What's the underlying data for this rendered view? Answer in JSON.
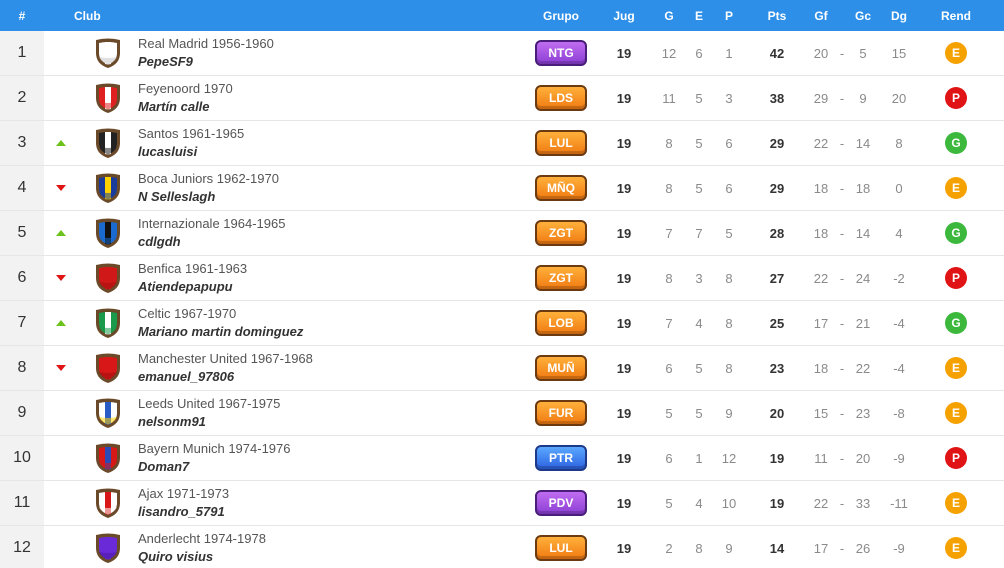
{
  "header": {
    "pos": "#",
    "club": "Club",
    "grupo": "Grupo",
    "jug": "Jug",
    "g": "G",
    "e": "E",
    "p": "P",
    "pts": "Pts",
    "gf": "Gf",
    "gc": "Gc",
    "dg": "Dg",
    "rend": "Rend"
  },
  "dash": "-",
  "rows": [
    {
      "pos": "1",
      "trend": "",
      "club": "Real Madrid 1956-1960",
      "user": "PepeSF9",
      "grupo": "NTG",
      "grupo_color": "purple",
      "jug": "19",
      "g": "12",
      "e": "6",
      "p": "1",
      "pts": "42",
      "gf": "20",
      "gc": "5",
      "dg": "15",
      "rend": "E",
      "rend_color": "#f5a200",
      "shield": [
        "#ffffff",
        "#ffffff",
        "#c7c7c7"
      ]
    },
    {
      "pos": "2",
      "trend": "",
      "club": "Feyenoord 1970",
      "user": "Martín calle",
      "grupo": "LDS",
      "grupo_color": "orange",
      "jug": "19",
      "g": "11",
      "e": "5",
      "p": "3",
      "pts": "38",
      "gf": "29",
      "gc": "9",
      "dg": "20",
      "rend": "P",
      "rend_color": "#e01414",
      "shield": [
        "#e02020",
        "#ffffff",
        "#e02020"
      ]
    },
    {
      "pos": "3",
      "trend": "up",
      "club": "Santos 1961-1965",
      "user": "lucasluisi",
      "grupo": "LUL",
      "grupo_color": "orange",
      "jug": "19",
      "g": "8",
      "e": "5",
      "p": "6",
      "pts": "29",
      "gf": "22",
      "gc": "14",
      "dg": "8",
      "rend": "G",
      "rend_color": "#3cb93c",
      "shield": [
        "#222222",
        "#ffffff",
        "#222222"
      ]
    },
    {
      "pos": "4",
      "trend": "down",
      "club": "Boca Juniors 1962-1970",
      "user": "N Selleslagh",
      "grupo": "MÑQ",
      "grupo_color": "orange",
      "jug": "19",
      "g": "8",
      "e": "5",
      "p": "6",
      "pts": "29",
      "gf": "18",
      "gc": "18",
      "dg": "0",
      "rend": "E",
      "rend_color": "#f5a200",
      "shield": [
        "#1a3d9c",
        "#ffd200",
        "#1a3d9c"
      ]
    },
    {
      "pos": "5",
      "trend": "up",
      "club": "Internazionale 1964-1965",
      "user": "cdlgdh",
      "grupo": "ZGT",
      "grupo_color": "orange",
      "jug": "19",
      "g": "7",
      "e": "7",
      "p": "5",
      "pts": "28",
      "gf": "18",
      "gc": "14",
      "dg": "4",
      "rend": "G",
      "rend_color": "#3cb93c",
      "shield": [
        "#1a6ad0",
        "#111111",
        "#1a6ad0"
      ]
    },
    {
      "pos": "6",
      "trend": "down",
      "club": "Benfica 1961-1963",
      "user": "Atiendepapupu",
      "grupo": "ZGT",
      "grupo_color": "orange",
      "jug": "19",
      "g": "8",
      "e": "3",
      "p": "8",
      "pts": "27",
      "gf": "22",
      "gc": "24",
      "dg": "-2",
      "rend": "P",
      "rend_color": "#e01414",
      "shield": [
        "#d01818",
        "#d01818",
        "#a81010"
      ]
    },
    {
      "pos": "7",
      "trend": "up",
      "club": "Celtic 1967-1970",
      "user": "Mariano martin dominguez",
      "grupo": "LOB",
      "grupo_color": "orange",
      "jug": "19",
      "g": "7",
      "e": "4",
      "p": "8",
      "pts": "25",
      "gf": "17",
      "gc": "21",
      "dg": "-4",
      "rend": "G",
      "rend_color": "#3cb93c",
      "shield": [
        "#1a9a4a",
        "#ffffff",
        "#1a9a4a"
      ]
    },
    {
      "pos": "8",
      "trend": "down",
      "club": "Manchester United 1967-1968",
      "user": "emanuel_97806",
      "grupo": "MUÑ",
      "grupo_color": "orange",
      "jug": "19",
      "g": "6",
      "e": "5",
      "p": "8",
      "pts": "23",
      "gf": "18",
      "gc": "22",
      "dg": "-4",
      "rend": "E",
      "rend_color": "#f5a200",
      "shield": [
        "#d81818",
        "#d81818",
        "#a00e0e"
      ]
    },
    {
      "pos": "9",
      "trend": "",
      "club": "Leeds United 1967-1975",
      "user": "nelsonm91",
      "grupo": "FUR",
      "grupo_color": "orange",
      "jug": "19",
      "g": "5",
      "e": "5",
      "p": "9",
      "pts": "20",
      "gf": "15",
      "gc": "23",
      "dg": "-8",
      "rend": "E",
      "rend_color": "#f5a200",
      "shield": [
        "#ffffff",
        "#2a5cc8",
        "#ffd200"
      ]
    },
    {
      "pos": "10",
      "trend": "",
      "club": "Bayern Munich 1974-1976",
      "user": "Doman7",
      "grupo": "PTR",
      "grupo_color": "blue",
      "jug": "19",
      "g": "6",
      "e": "1",
      "p": "12",
      "pts": "19",
      "gf": "11",
      "gc": "20",
      "dg": "-9",
      "rend": "P",
      "rend_color": "#e01414",
      "shield": [
        "#d81818",
        "#2a4ab8",
        "#d81818"
      ]
    },
    {
      "pos": "11",
      "trend": "",
      "club": "Ajax 1971-1973",
      "user": "lisandro_5791",
      "grupo": "PDV",
      "grupo_color": "purple",
      "jug": "19",
      "g": "5",
      "e": "4",
      "p": "10",
      "pts": "19",
      "gf": "22",
      "gc": "33",
      "dg": "-11",
      "rend": "E",
      "rend_color": "#f5a200",
      "shield": [
        "#ffffff",
        "#d81818",
        "#ffffff"
      ]
    },
    {
      "pos": "12",
      "trend": "",
      "club": "Anderlecht 1974-1978",
      "user": "Quiro visius",
      "grupo": "LUL",
      "grupo_color": "orange",
      "jug": "19",
      "g": "2",
      "e": "8",
      "p": "9",
      "pts": "14",
      "gf": "17",
      "gc": "26",
      "dg": "-9",
      "rend": "E",
      "rend_color": "#f5a200",
      "shield": [
        "#6a2ad8",
        "#6a2ad8",
        "#4a18a8"
      ]
    }
  ]
}
